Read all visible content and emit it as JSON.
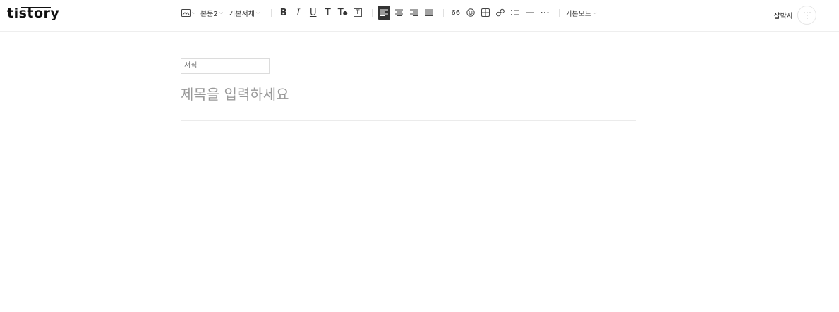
{
  "brand": {
    "logo_text": "tistory"
  },
  "toolbar": {
    "image_icon": "image-icon",
    "paragraph_style": "본문2",
    "font_family": "기본서체",
    "bold": "B",
    "italic": "I",
    "underline": "U",
    "strike": "T",
    "text_color": "T",
    "bg_color": "T",
    "quote": "66",
    "mode": "기본모드"
  },
  "user": {
    "name": "잡박사"
  },
  "editor": {
    "category_placeholder": "서식",
    "title_placeholder": "제목을 입력하세요"
  },
  "colors": {
    "active_bg": "#333333",
    "muted_text": "#999999",
    "divider": "#ebebeb"
  }
}
